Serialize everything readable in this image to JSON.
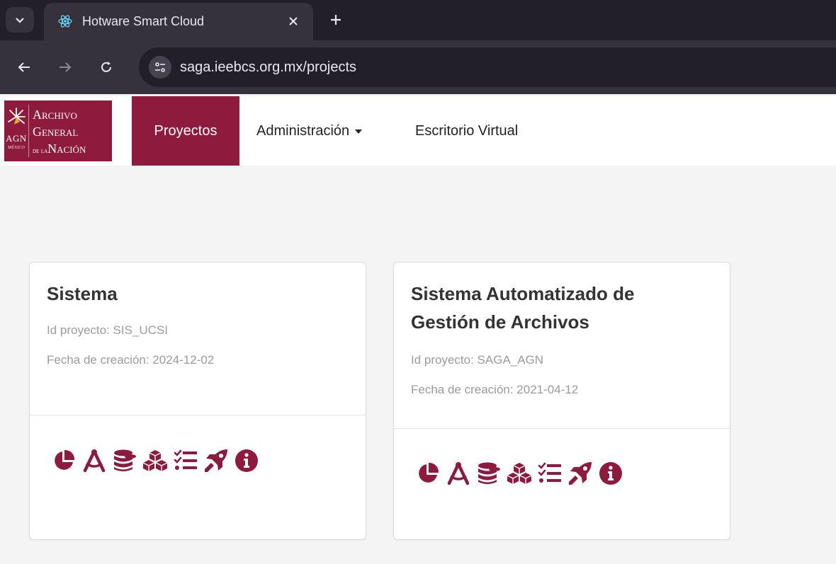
{
  "browser": {
    "tab_title": "Hotware Smart Cloud",
    "url": "saga.ieebcs.org.mx/projects",
    "icons": [
      "chevron-down-icon",
      "react-favicon-icon",
      "close-icon",
      "plus-icon",
      "back-icon",
      "forward-icon",
      "reload-icon",
      "site-settings-icon"
    ]
  },
  "logo": {
    "line1": "Archivo",
    "line2": "General",
    "line3_prefix": "de la",
    "line3": "Nación",
    "badge": "AGN",
    "badge_sub": "MÉXICO"
  },
  "nav": {
    "items": [
      {
        "label": "Proyectos",
        "active": true
      },
      {
        "label": "Administración",
        "dropdown": true
      },
      {
        "label": "Escritorio Virtual"
      }
    ]
  },
  "colors": {
    "brand": "#8e1b3e",
    "background": "#f4f4f4",
    "muted_text": "#9b9b9b"
  },
  "projects": [
    {
      "title": "Sistema",
      "id_label": "Id proyecto: SIS_UCSI",
      "date_label": "Fecha de creación: 2024-12-02",
      "actions": [
        "pie-chart-icon",
        "drafting-compass-icon",
        "database-icon",
        "cubes-icon",
        "tasks-list-icon",
        "rocket-icon",
        "info-icon"
      ]
    },
    {
      "title": "Sistema Automatizado de Gestión de Archivos",
      "id_label": "Id proyecto: SAGA_AGN",
      "date_label": "Fecha de creación: 2021-04-12",
      "actions": [
        "pie-chart-icon",
        "drafting-compass-icon",
        "database-icon",
        "cubes-icon",
        "tasks-list-icon",
        "rocket-icon",
        "info-icon"
      ]
    }
  ]
}
